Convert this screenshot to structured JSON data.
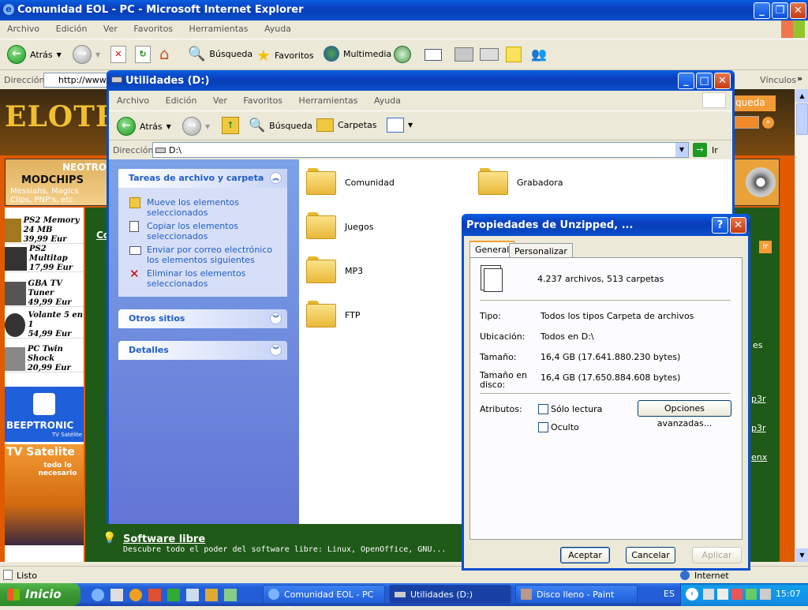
{
  "ie": {
    "title": "Comunidad EOL - PC - Microsoft Internet Explorer",
    "menu": [
      "Archivo",
      "Edición",
      "Ver",
      "Favoritos",
      "Herramientas",
      "Ayuda"
    ],
    "toolbar": {
      "back": "Atrás",
      "search": "Búsqueda",
      "favorites": "Favoritos",
      "media": "Multimedia"
    },
    "address_label": "Dirección",
    "address_value": "http://www.",
    "links_label": "Vínculos",
    "status": "Listo",
    "zone": "Internet"
  },
  "website": {
    "logo": "ELOTROL",
    "banner_top": "NEOTRO",
    "banner_main": "MODCHIPS",
    "banner_sub1": "Messiahs, Magics",
    "banner_sub2": "Clips, PNP's, etc.",
    "banner_extra": "P",
    "search_button": "queda",
    "go_button": "Ir",
    "products": [
      {
        "name": "PS2 Memory 24 MB",
        "price": "39,99 Eur"
      },
      {
        "name": "PS2 Multitap",
        "price": "17,99 Eur"
      },
      {
        "name": "GBA TV Tuner",
        "price": "49,99 Eur"
      },
      {
        "name": "Volante 5 en 1",
        "price": "54,99 Eur"
      },
      {
        "name": "PC Twin Shock",
        "price": "20,99 Eur"
      }
    ],
    "beeptronic": "BEEPTRONIC",
    "beeptronic_sub": "TV Satélite",
    "tv_satelite": "TV Satelite",
    "tv_tagline": "todo lo necesario",
    "software_title": "Software libre",
    "software_desc": "Descubre todo el poder del software libre: Linux, OpenOffice, GNU...",
    "side_labels": [
      "es",
      "p3r",
      "p3r",
      "enx"
    ]
  },
  "explorer": {
    "title": "Utilidades (D:)",
    "menu": [
      "Archivo",
      "Edición",
      "Ver",
      "Favoritos",
      "Herramientas",
      "Ayuda"
    ],
    "toolbar": {
      "back": "Atrás",
      "search": "Búsqueda",
      "folders": "Carpetas"
    },
    "address_label": "Dirección",
    "address_value": "D:\\",
    "go": "Ir",
    "tasks_title": "Tareas de archivo y carpeta",
    "tasks": [
      {
        "text": "Mueve los elementos seleccionados",
        "icon": "move-icon"
      },
      {
        "text": "Copiar los elementos seleccionados",
        "icon": "copy-icon"
      },
      {
        "text": "Enviar por correo electrónico los elementos siguientes",
        "icon": "email-icon"
      },
      {
        "text": "Eliminar los elementos seleccionados",
        "icon": "delete-icon"
      }
    ],
    "other_places": "Otros sitios",
    "details": "Detalles",
    "folders": [
      "Comunidad",
      "Grabadora",
      "Juegos",
      "MP3",
      "FTP"
    ]
  },
  "dialog": {
    "title": "Propiedades de Unzipped, ...",
    "tabs": [
      "General",
      "Personalizar"
    ],
    "summary": "4.237 archivos, 513 carpetas",
    "rows": [
      {
        "label": "Tipo:",
        "value": "Todos los tipos Carpeta de archivos"
      },
      {
        "label": "Ubicación:",
        "value": "Todos en D:\\"
      },
      {
        "label": "Tamaño:",
        "value": "16,4 GB (17.641.880.230 bytes)"
      },
      {
        "label": "Tamaño en disco:",
        "value": "16,4 GB (17.650.884.608 bytes)"
      }
    ],
    "attributes_label": "Atributos:",
    "readonly": "Sólo lectura",
    "hidden": "Oculto",
    "advanced": "Opciones avanzadas...",
    "ok": "Aceptar",
    "cancel": "Cancelar",
    "apply": "Aplicar"
  },
  "taskbar": {
    "start": "Inicio",
    "buttons": [
      "Comunidad EOL - PC ...",
      "Utilidades (D:)",
      "Disco lleno - Paint"
    ],
    "lang": "ES",
    "clock": "15:07"
  },
  "colors": {
    "xp_blue": "#0a50d0",
    "task_blue": "#215dc6",
    "site_orange": "#e05a00",
    "site_green": "#1f5a18"
  }
}
